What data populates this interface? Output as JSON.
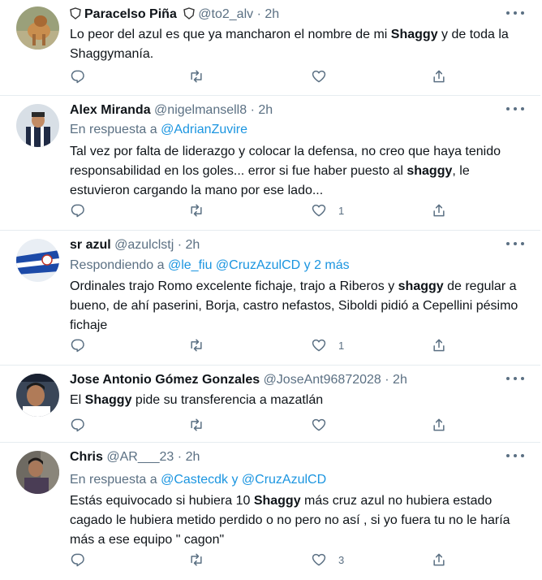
{
  "tweets": [
    {
      "name": "Paracelso Piña",
      "name_prefix_icon": "shield-emoji-icon",
      "name_suffix_icon": "shield-emoji-icon",
      "handle": "@to2_alv",
      "time": "2h",
      "reply_label": "",
      "reply_users": "",
      "text_parts": [
        "Lo peor del azul es que ya mancharon el nombre de mi ",
        "Shaggy",
        " y de toda la Shaggymanía."
      ],
      "likes": ""
    },
    {
      "name": "Alex Miranda",
      "handle": "@nigelmansell8",
      "time": "2h",
      "reply_label": "En respuesta a ",
      "reply_users": "@AdrianZuvire",
      "text_parts": [
        "Tal vez por falta de liderazgo y colocar la defensa, no creo que haya tenido responsabilidad en los goles... error si fue haber puesto al ",
        "shaggy",
        ", le estuvieron cargando la mano por ese lado..."
      ],
      "likes": "1"
    },
    {
      "name": "sr azul",
      "handle": "@azulclstj",
      "time": "2h",
      "reply_label": "Respondiendo a ",
      "reply_users": "@le_fiu @CruzAzulCD y 2 más",
      "text_parts": [
        "Ordinales trajo Romo excelente fichaje, trajo a Riberos y ",
        "shaggy",
        " de regular a bueno, de ahí paserini, Borja, castro nefastos, Siboldi pidió a Cepellini pésimo fichaje"
      ],
      "likes": "1"
    },
    {
      "name": "Jose Antonio Gómez Gonzales",
      "handle": "@JoseAnt96872028",
      "time": "2h",
      "reply_label": "",
      "reply_users": "",
      "text_parts": [
        "El ",
        "Shaggy",
        " pide su transferencia a mazatlán"
      ],
      "likes": ""
    },
    {
      "name": "Chris",
      "handle": "@AR___23",
      "time": "2h",
      "reply_label": "En respuesta a ",
      "reply_users": "@Castecdk y @CruzAzulCD",
      "text_parts": [
        "Estás equivocado si hubiera 10 ",
        "Shaggy",
        " más cruz azul no hubiera estado cagado le hubiera metido perdido o no pero no así , si yo fuera tu no le haría más a ese equipo \" cagon\""
      ],
      "likes": "3"
    }
  ],
  "dot": "·",
  "icons": {
    "reply": "reply-icon",
    "retweet": "retweet-icon",
    "like": "heart-icon",
    "share": "share-icon",
    "more": "more-options-icon"
  },
  "colors": {
    "text": "#0f1419",
    "muted": "#5b7083",
    "link": "#1b95e0",
    "divider": "#e6ecf0"
  }
}
